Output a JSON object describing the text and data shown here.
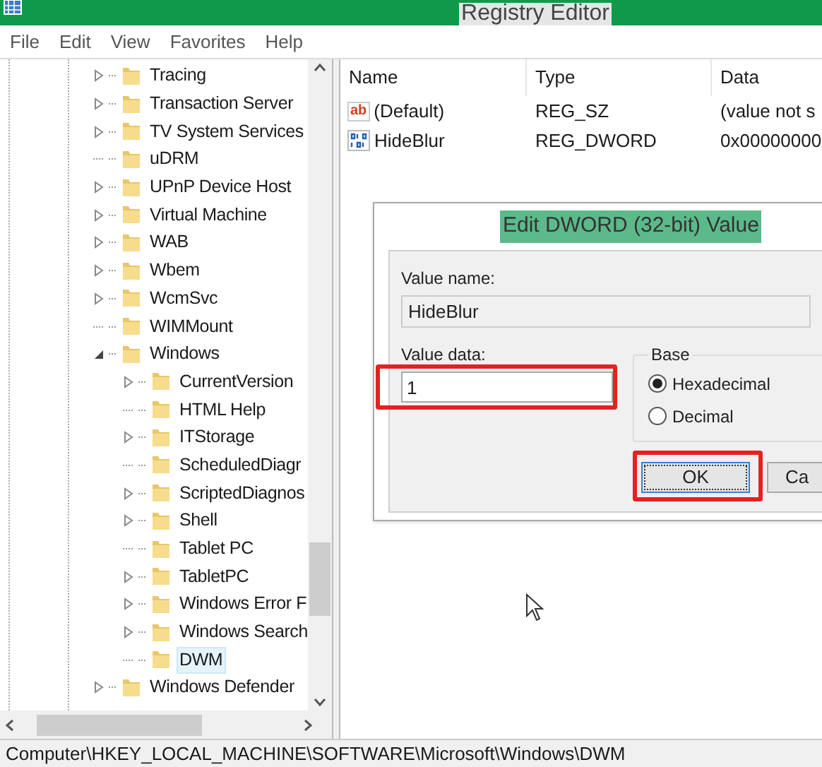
{
  "window": {
    "title": "Registry Editor"
  },
  "menu": [
    "File",
    "Edit",
    "View",
    "Favorites",
    "Help"
  ],
  "tree": [
    {
      "label": "Tracing",
      "expanded": false,
      "selected": false
    },
    {
      "label": "Transaction Server",
      "expanded": false,
      "selected": false
    },
    {
      "label": "TV System Services",
      "expanded": false,
      "selected": false
    },
    {
      "label": "uDRM",
      "selected": false
    },
    {
      "label": "UPnP Device Host",
      "expanded": false,
      "selected": false
    },
    {
      "label": "Virtual Machine",
      "expanded": false,
      "selected": false
    },
    {
      "label": "WAB",
      "expanded": false,
      "selected": false
    },
    {
      "label": "Wbem",
      "expanded": false,
      "selected": false
    },
    {
      "label": "WcmSvc",
      "expanded": false,
      "selected": false
    },
    {
      "label": "WIMMount",
      "selected": false
    },
    {
      "label": "Windows",
      "expanded": true,
      "selected": false,
      "children": [
        {
          "label": "CurrentVersion",
          "expanded": false,
          "selected": false
        },
        {
          "label": "HTML Help",
          "selected": false
        },
        {
          "label": "ITStorage",
          "expanded": false,
          "selected": false
        },
        {
          "label": "ScheduledDiagr",
          "selected": false
        },
        {
          "label": "ScriptedDiagnos",
          "expanded": false,
          "selected": false
        },
        {
          "label": "Shell",
          "expanded": false,
          "selected": false
        },
        {
          "label": "Tablet PC",
          "selected": false
        },
        {
          "label": "TabletPC",
          "expanded": false,
          "selected": false
        },
        {
          "label": "Windows Error F",
          "expanded": false,
          "selected": false
        },
        {
          "label": "Windows Search",
          "expanded": false,
          "selected": false
        },
        {
          "label": "DWM",
          "selected": true
        }
      ]
    },
    {
      "label": "Windows Defender",
      "expanded": false,
      "selected": false
    }
  ],
  "values": {
    "columns": [
      "Name",
      "Type",
      "Data"
    ],
    "rows": [
      {
        "kind": "string",
        "icon_text": "ab",
        "name": "(Default)",
        "type": "REG_SZ",
        "data": "(value not s"
      },
      {
        "kind": "binary",
        "name": "HideBlur",
        "type": "REG_DWORD",
        "data": "0x00000000"
      }
    ]
  },
  "dialog": {
    "title": "Edit DWORD (32-bit) Value",
    "value_name_label": "Value name:",
    "value_name": "HideBlur",
    "value_data_label": "Value data:",
    "value_data": "1",
    "base_label": "Base",
    "bases": [
      {
        "label": "Hexadecimal",
        "selected": true
      },
      {
        "label": "Decimal",
        "selected": false
      }
    ],
    "buttons": [
      "OK",
      "Ca"
    ]
  },
  "status_bar": "Computer\\HKEY_LOCAL_MACHINE\\SOFTWARE\\Microsoft\\Windows\\DWM"
}
